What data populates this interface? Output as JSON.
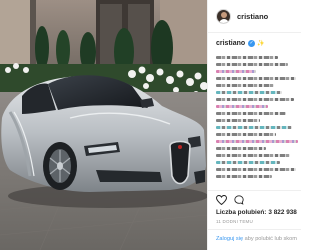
{
  "post": {
    "username": "cristiano",
    "caption_username": "cristiano",
    "caption_tail": "",
    "likes_label": "Liczba polubień:",
    "likes_count": "3 822 938",
    "timestamp": "11 DODNI TEMU"
  },
  "actions": {
    "like_icon": "heart-icon",
    "comment_icon": "comment-icon"
  },
  "footer": {
    "login_link": "Zaloguj się",
    "login_suffix": " aby polubić lub skom"
  },
  "colors": {
    "link": "#3897f0",
    "verified": "#3897f0",
    "text": "#262626",
    "muted": "#999999",
    "car_body": "#c5c9cd",
    "car_dark": "#2c3035"
  }
}
